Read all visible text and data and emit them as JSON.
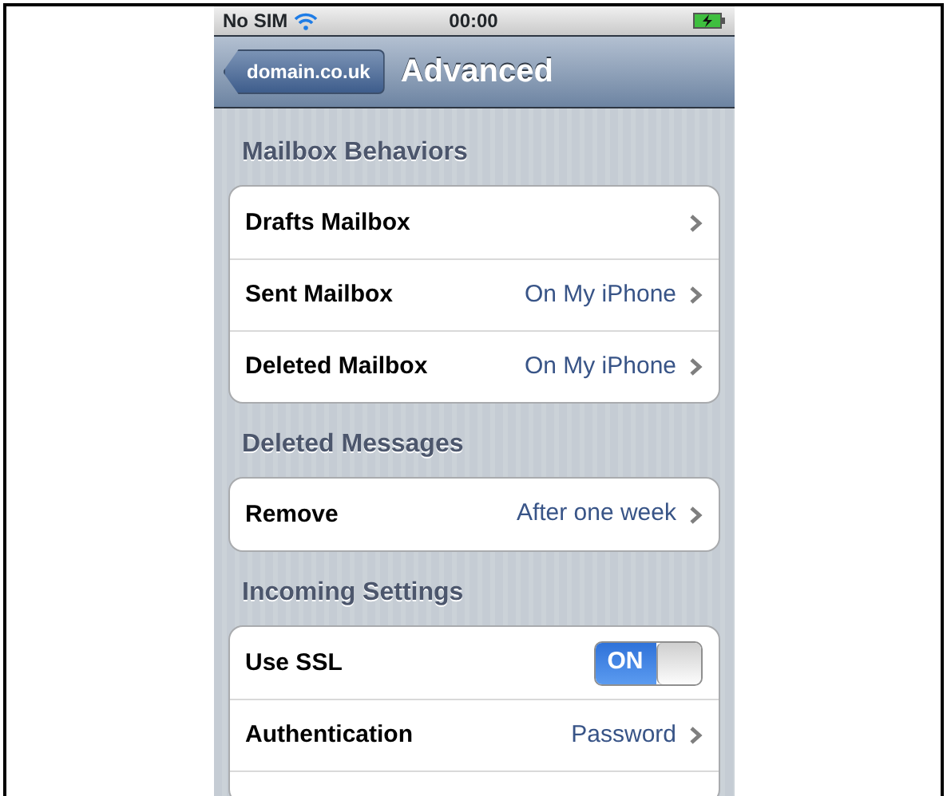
{
  "status_bar": {
    "carrier": "No SIM",
    "time": "00:00"
  },
  "nav_bar": {
    "back_button": "domain.co.uk",
    "title": "Advanced"
  },
  "sections": [
    {
      "header": "Mailbox Behaviors",
      "continues": false,
      "rows": [
        {
          "kind": "link",
          "label": "Drafts Mailbox"
        },
        {
          "kind": "link",
          "label": "Sent Mailbox",
          "value": "On My iPhone"
        },
        {
          "kind": "link",
          "label": "Deleted Mailbox",
          "value": "On My iPhone"
        }
      ]
    },
    {
      "header": "Deleted Messages",
      "continues": false,
      "rows": [
        {
          "kind": "link",
          "label": "Remove",
          "value": "After one week"
        }
      ]
    },
    {
      "header": "Incoming Settings",
      "continues": true,
      "rows": [
        {
          "kind": "switch",
          "label": "Use SSL",
          "on": true,
          "switch_text": "ON"
        },
        {
          "kind": "link",
          "label": "Authentication",
          "value": "Password"
        }
      ]
    }
  ]
}
